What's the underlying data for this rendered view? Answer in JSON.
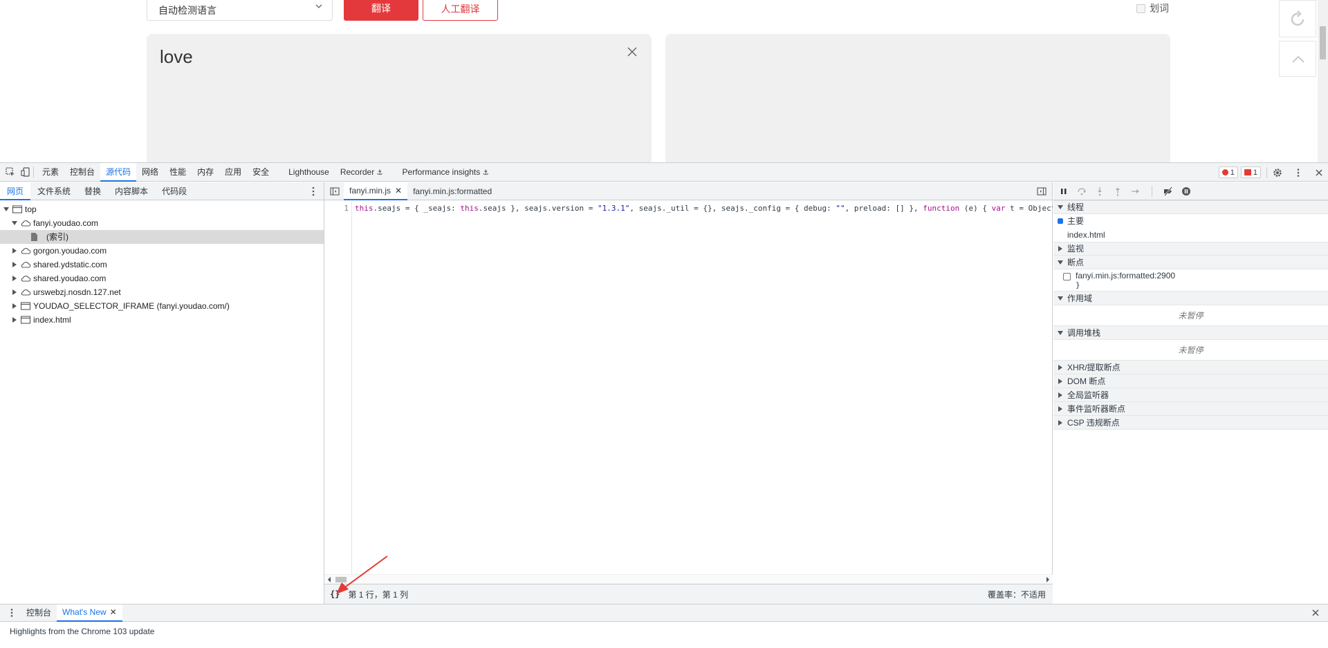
{
  "page": {
    "lang_select": "自动检测语言",
    "translate_button": "翻译",
    "human_translate_button": "人工翻译",
    "huaci_label": "划词",
    "source_text": "love"
  },
  "devtools": {
    "main_tabs": [
      "元素",
      "控制台",
      "源代码",
      "网络",
      "性能",
      "内存",
      "应用",
      "安全",
      "Lighthouse",
      "Recorder",
      "Performance insights"
    ],
    "active_main_tab": "源代码",
    "error_count": "1",
    "issue_count": "1",
    "navigator": {
      "tabs": [
        "网页",
        "文件系统",
        "替换",
        "内容脚本",
        "代码段"
      ],
      "tree": [
        {
          "label": "top",
          "depth": 0,
          "expanded": true,
          "icon": "frame-icon"
        },
        {
          "label": "fanyi.youdao.com",
          "depth": 1,
          "expanded": true,
          "icon": "cloud-icon"
        },
        {
          "label": "(索引)",
          "depth": 2,
          "icon": "file-icon",
          "selected": true
        },
        {
          "label": "gorgon.youdao.com",
          "depth": 1,
          "expanded": false,
          "icon": "cloud-icon"
        },
        {
          "label": "shared.ydstatic.com",
          "depth": 1,
          "expanded": false,
          "icon": "cloud-icon"
        },
        {
          "label": "shared.youdao.com",
          "depth": 1,
          "expanded": false,
          "icon": "cloud-icon"
        },
        {
          "label": "urswebzj.nosdn.127.net",
          "depth": 1,
          "expanded": false,
          "icon": "cloud-icon"
        },
        {
          "label": "YOUDAO_SELECTOR_IFRAME (fanyi.youdao.com/)",
          "depth": 1,
          "expanded": false,
          "icon": "frame-icon"
        },
        {
          "label": "index.html",
          "depth": 1,
          "expanded": false,
          "icon": "frame-icon"
        }
      ]
    },
    "editor": {
      "tabs": [
        {
          "label": "fanyi.min.js",
          "active": true
        },
        {
          "label": "fanyi.min.js:formatted",
          "active": false
        }
      ],
      "line_number": "1",
      "code": {
        "p1": "this",
        "p2": ".seajs = { _seajs: ",
        "p3": "this",
        "p4": ".seajs }, seajs.version = ",
        "p5": "\"1.3.1\"",
        "p6": ", seajs._util = {}, seajs._config = { debug: ",
        "p7": "\"\"",
        "p8": ", preload: [] }, ",
        "p9": "function",
        "p10": " (e) { ",
        "p11": "var",
        "p12": " t = Object.prototype.toString"
      },
      "pretty_print": "{}",
      "position": "第 1 行，第 1 列",
      "coverage": "覆盖率：不适用"
    },
    "debugger": {
      "threads": "线程",
      "thread_main": "主要",
      "thread_index": "index.html",
      "watch": "监视",
      "breakpoints": "断点",
      "bp_file": "fanyi.min.js:formatted:2900",
      "bp_code": "}",
      "scope": "作用域",
      "scope_empty": "未暂停",
      "callstack": "调用堆栈",
      "callstack_empty": "未暂停",
      "xhr": "XHR/提取断点",
      "dom": "DOM 断点",
      "global": "全局监听器",
      "event": "事件监听器断点",
      "csp": "CSP 违规断点"
    },
    "drawer": {
      "tabs": [
        "控制台",
        "What's New"
      ],
      "active": "What's New",
      "body": "Highlights from the Chrome 103 update"
    }
  },
  "colors": {
    "accent": "#1a73e8",
    "brand_red": "#e4393c"
  }
}
